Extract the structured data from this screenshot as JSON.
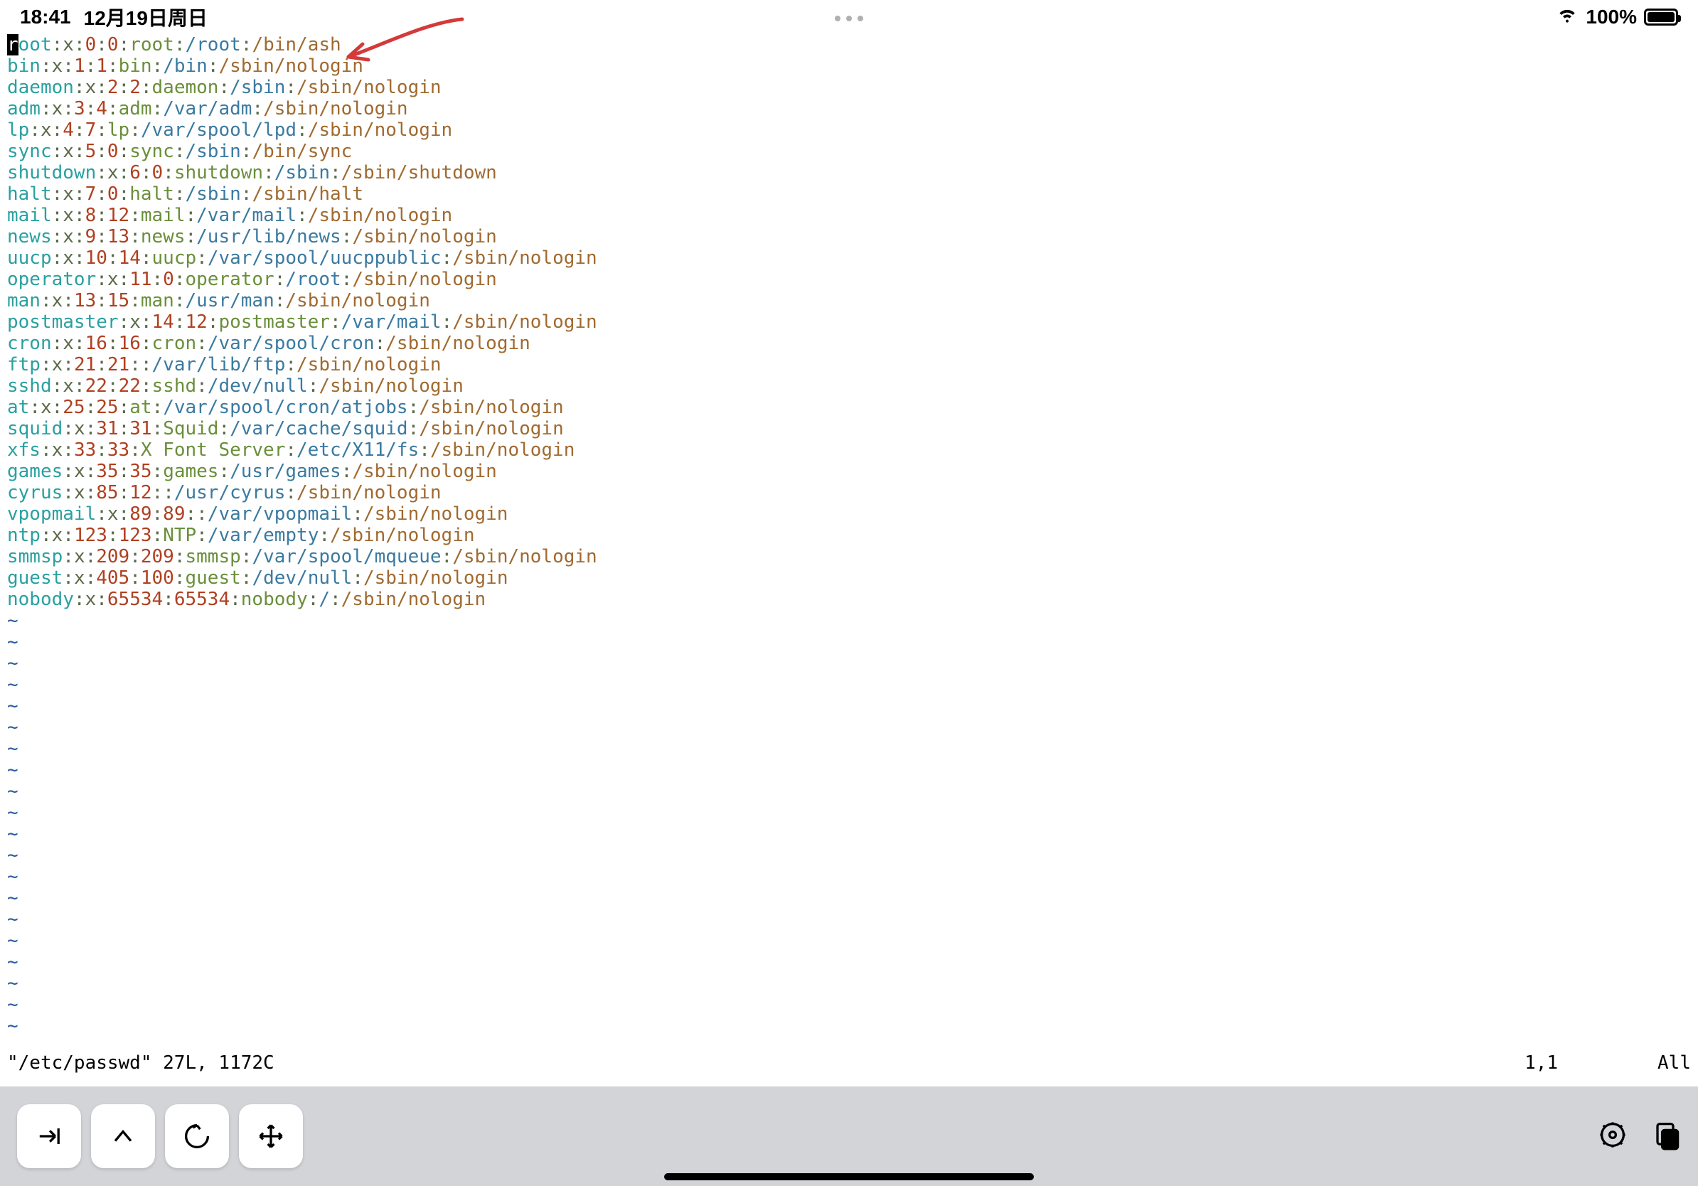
{
  "status": {
    "time": "18:41",
    "date": "12月19日周日",
    "battery_pct": "100%"
  },
  "vim_status": {
    "file": "\"/etc/passwd\" 27L, 1172C",
    "pos": "1,1",
    "scroll": "All"
  },
  "lines": [
    {
      "user": "root",
      "uid": "0",
      "gid": "0",
      "gecos": "root",
      "home": "/root",
      "shell": "/bin/ash",
      "cursor": true
    },
    {
      "user": "bin",
      "uid": "1",
      "gid": "1",
      "gecos": "bin",
      "home": "/bin",
      "shell": "/sbin/nologin"
    },
    {
      "user": "daemon",
      "uid": "2",
      "gid": "2",
      "gecos": "daemon",
      "home": "/sbin",
      "shell": "/sbin/nologin"
    },
    {
      "user": "adm",
      "uid": "3",
      "gid": "4",
      "gecos": "adm",
      "home": "/var/adm",
      "shell": "/sbin/nologin"
    },
    {
      "user": "lp",
      "uid": "4",
      "gid": "7",
      "gecos": "lp",
      "home": "/var/spool/lpd",
      "shell": "/sbin/nologin"
    },
    {
      "user": "sync",
      "uid": "5",
      "gid": "0",
      "gecos": "sync",
      "home": "/sbin",
      "shell": "/bin/sync"
    },
    {
      "user": "shutdown",
      "uid": "6",
      "gid": "0",
      "gecos": "shutdown",
      "home": "/sbin",
      "shell": "/sbin/shutdown"
    },
    {
      "user": "halt",
      "uid": "7",
      "gid": "0",
      "gecos": "halt",
      "home": "/sbin",
      "shell": "/sbin/halt"
    },
    {
      "user": "mail",
      "uid": "8",
      "gid": "12",
      "gecos": "mail",
      "home": "/var/mail",
      "shell": "/sbin/nologin"
    },
    {
      "user": "news",
      "uid": "9",
      "gid": "13",
      "gecos": "news",
      "home": "/usr/lib/news",
      "shell": "/sbin/nologin"
    },
    {
      "user": "uucp",
      "uid": "10",
      "gid": "14",
      "gecos": "uucp",
      "home": "/var/spool/uucppublic",
      "shell": "/sbin/nologin"
    },
    {
      "user": "operator",
      "uid": "11",
      "gid": "0",
      "gecos": "operator",
      "home": "/root",
      "shell": "/sbin/nologin"
    },
    {
      "user": "man",
      "uid": "13",
      "gid": "15",
      "gecos": "man",
      "home": "/usr/man",
      "shell": "/sbin/nologin"
    },
    {
      "user": "postmaster",
      "uid": "14",
      "gid": "12",
      "gecos": "postmaster",
      "home": "/var/mail",
      "shell": "/sbin/nologin"
    },
    {
      "user": "cron",
      "uid": "16",
      "gid": "16",
      "gecos": "cron",
      "home": "/var/spool/cron",
      "shell": "/sbin/nologin"
    },
    {
      "user": "ftp",
      "uid": "21",
      "gid": "21",
      "gecos": "",
      "home": "/var/lib/ftp",
      "shell": "/sbin/nologin"
    },
    {
      "user": "sshd",
      "uid": "22",
      "gid": "22",
      "gecos": "sshd",
      "home": "/dev/null",
      "shell": "/sbin/nologin"
    },
    {
      "user": "at",
      "uid": "25",
      "gid": "25",
      "gecos": "at",
      "home": "/var/spool/cron/atjobs",
      "shell": "/sbin/nologin"
    },
    {
      "user": "squid",
      "uid": "31",
      "gid": "31",
      "gecos": "Squid",
      "home": "/var/cache/squid",
      "shell": "/sbin/nologin"
    },
    {
      "user": "xfs",
      "uid": "33",
      "gid": "33",
      "gecos": "X Font Server",
      "home": "/etc/X11/fs",
      "shell": "/sbin/nologin"
    },
    {
      "user": "games",
      "uid": "35",
      "gid": "35",
      "gecos": "games",
      "home": "/usr/games",
      "shell": "/sbin/nologin"
    },
    {
      "user": "cyrus",
      "uid": "85",
      "gid": "12",
      "gecos": "",
      "home": "/usr/cyrus",
      "shell": "/sbin/nologin"
    },
    {
      "user": "vpopmail",
      "uid": "89",
      "gid": "89",
      "gecos": "",
      "home": "/var/vpopmail",
      "shell": "/sbin/nologin"
    },
    {
      "user": "ntp",
      "uid": "123",
      "gid": "123",
      "gecos": "NTP",
      "home": "/var/empty",
      "shell": "/sbin/nologin"
    },
    {
      "user": "smmsp",
      "uid": "209",
      "gid": "209",
      "gecos": "smmsp",
      "home": "/var/spool/mqueue",
      "shell": "/sbin/nologin"
    },
    {
      "user": "guest",
      "uid": "405",
      "gid": "100",
      "gecos": "guest",
      "home": "/dev/null",
      "shell": "/sbin/nologin"
    },
    {
      "user": "nobody",
      "uid": "65534",
      "gid": "65534",
      "gecos": "nobody",
      "home": "/",
      "shell": "/sbin/nologin"
    }
  ],
  "tilde_count": 20,
  "colors": {
    "arrow": "#d43a3a"
  }
}
